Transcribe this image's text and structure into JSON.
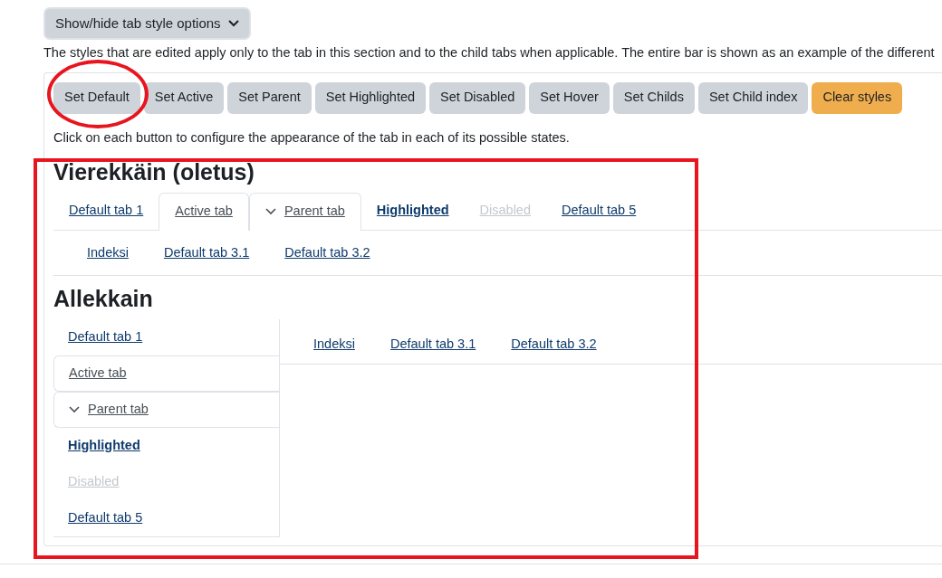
{
  "toggle_button": {
    "label": "Show/hide tab style options"
  },
  "description": "The styles that are edited apply only to the tab in this section and to the child tabs when applicable. The entire bar is shown as an example of the different",
  "style_buttons": [
    {
      "label": "Set Default",
      "kind": "normal"
    },
    {
      "label": "Set Active",
      "kind": "normal"
    },
    {
      "label": "Set Parent",
      "kind": "normal"
    },
    {
      "label": "Set Highlighted",
      "kind": "normal"
    },
    {
      "label": "Set Disabled",
      "kind": "normal"
    },
    {
      "label": "Set Hover",
      "kind": "normal"
    },
    {
      "label": "Set Childs",
      "kind": "normal"
    },
    {
      "label": "Set Child index",
      "kind": "normal"
    },
    {
      "label": "Clear styles",
      "kind": "warning"
    }
  ],
  "hint": "Click on each button to configure the appearance of the tab in each of its possible states.",
  "horizontal": {
    "title": "Vierekkäin (oletus)",
    "tabs": [
      {
        "label": "Default tab 1",
        "kind": "default"
      },
      {
        "label": "Active tab",
        "kind": "active"
      },
      {
        "label": "Parent tab",
        "kind": "parent"
      },
      {
        "label": "Highlighted",
        "kind": "highlighted"
      },
      {
        "label": "Disabled",
        "kind": "disabled"
      },
      {
        "label": "Default tab 5",
        "kind": "default"
      }
    ],
    "child_tabs": [
      "Indeksi",
      "Default tab 3.1",
      "Default tab 3.2"
    ]
  },
  "vertical": {
    "title": "Allekkain",
    "tabs": [
      {
        "label": "Default tab 1",
        "kind": "default"
      },
      {
        "label": "Active tab",
        "kind": "active"
      },
      {
        "label": "Parent tab",
        "kind": "parent"
      },
      {
        "label": "Highlighted",
        "kind": "highlighted"
      },
      {
        "label": "Disabled",
        "kind": "disabled"
      },
      {
        "label": "Default tab 5",
        "kind": "default"
      }
    ],
    "child_tabs": [
      "Indeksi",
      "Default tab 3.1",
      "Default tab 3.2"
    ]
  },
  "annotations": [
    {
      "kind": "ellipse",
      "color": "#e8151f"
    },
    {
      "kind": "rectangle",
      "color": "#e8151f"
    }
  ]
}
